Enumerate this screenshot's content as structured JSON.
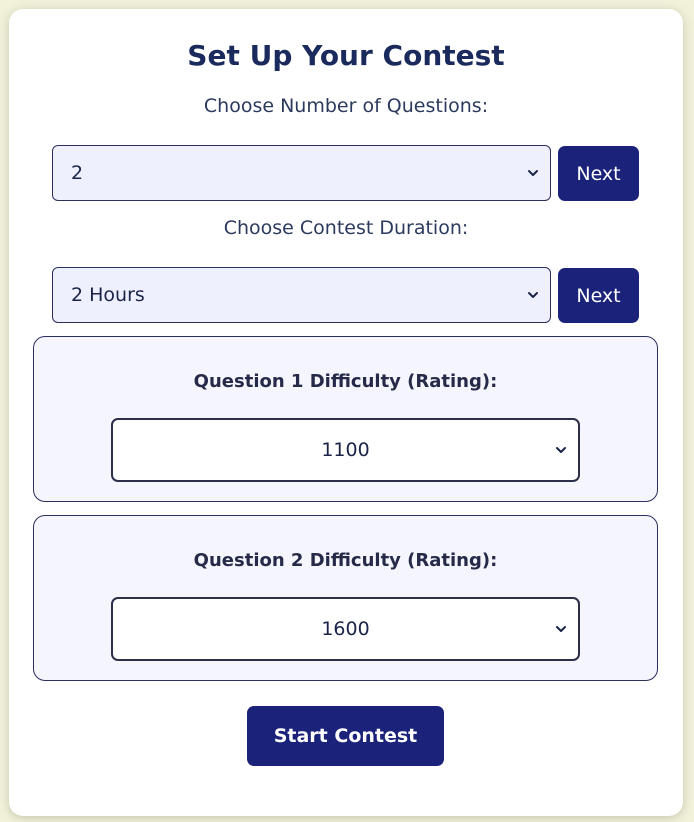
{
  "page": {
    "title": "Set Up Your Contest"
  },
  "questions_count": {
    "label": "Choose Number of Questions:",
    "selected": "2",
    "next_label": "Next"
  },
  "duration": {
    "label": "Choose Contest Duration:",
    "selected": "2 Hours",
    "next_label": "Next"
  },
  "questions": [
    {
      "label": "Question 1 Difficulty (Rating):",
      "rating": "1100"
    },
    {
      "label": "Question 2 Difficulty (Rating):",
      "rating": "1600"
    }
  ],
  "actions": {
    "start_label": "Start Contest"
  },
  "colors": {
    "page_background": "#f2f1da",
    "card_background": "#ffffff",
    "primary_button": "#1b227a",
    "title_text": "#1b2a5c",
    "select_background": "#eef1fd",
    "panel_background": "#f4f5fd"
  },
  "icons": {
    "select_arrow": "chevron-down-icon"
  }
}
